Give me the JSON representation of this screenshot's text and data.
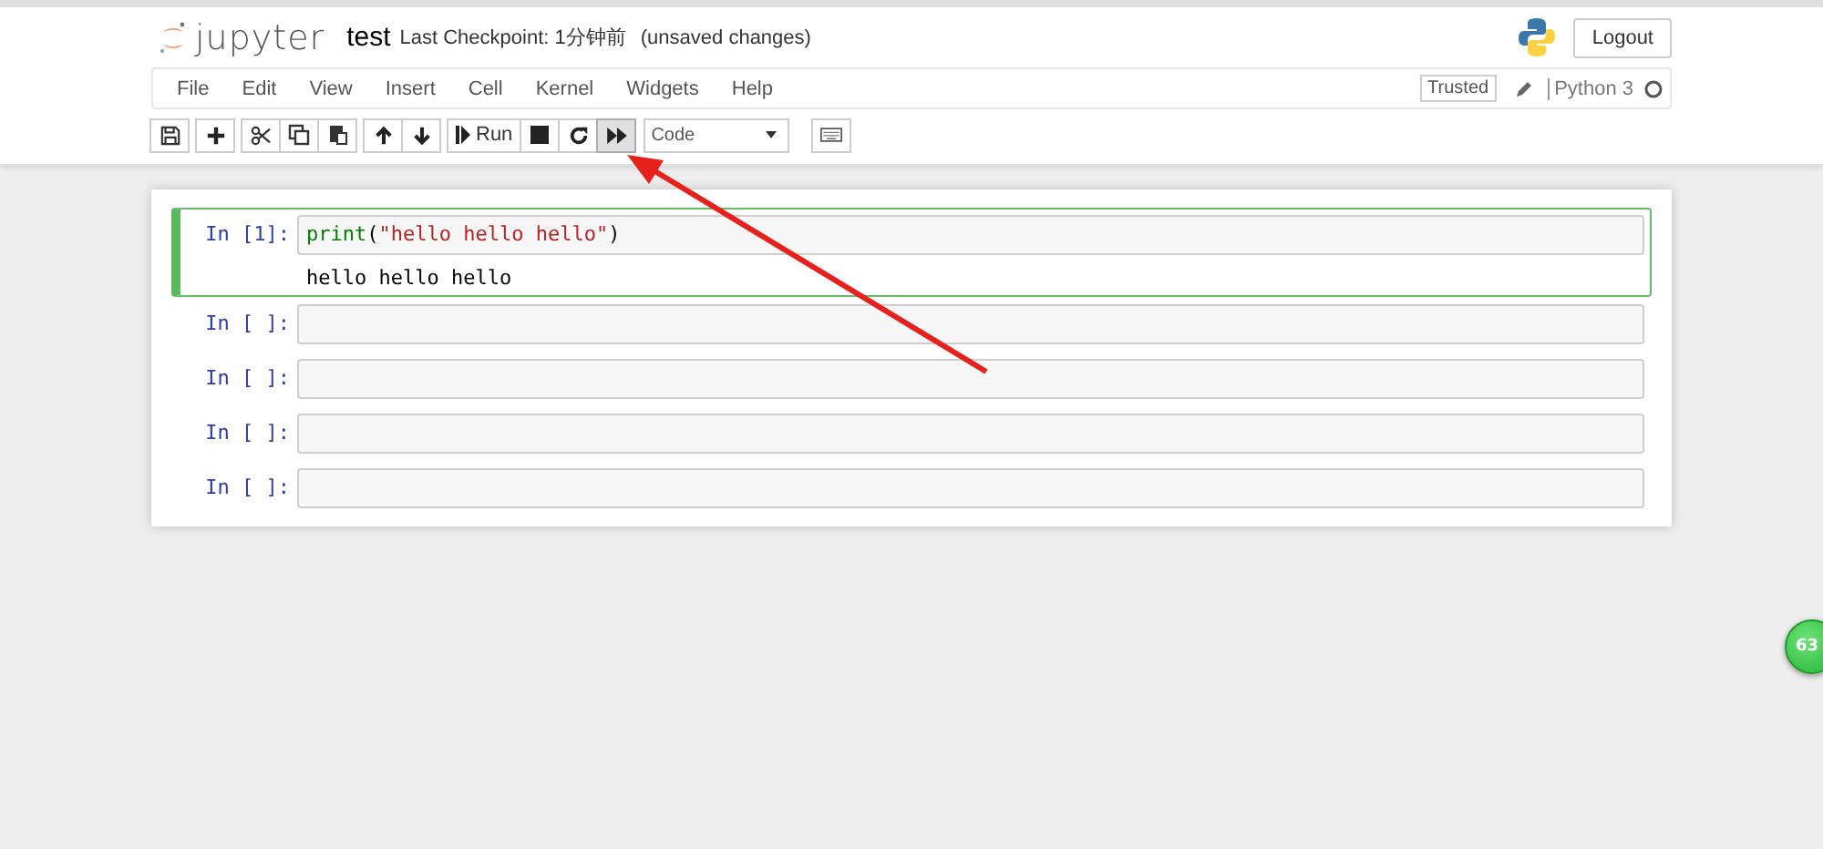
{
  "header": {
    "logo_text": "jupyter",
    "notebook_name": "test",
    "checkpoint": "Last Checkpoint: 1分钟前",
    "autosave_status": "(unsaved changes)",
    "logout": "Logout"
  },
  "menu": [
    "File",
    "Edit",
    "View",
    "Insert",
    "Cell",
    "Kernel",
    "Widgets",
    "Help"
  ],
  "kernel_status": {
    "trusted": "Trusted",
    "kernel_name": "Python 3",
    "busy": false
  },
  "toolbar": [
    [
      {
        "kind": "save",
        "pressed": false
      }
    ],
    [
      {
        "kind": "add",
        "pressed": false
      }
    ],
    [
      {
        "kind": "cut",
        "pressed": false
      },
      {
        "kind": "copy",
        "pressed": false
      },
      {
        "kind": "paste",
        "pressed": false
      }
    ],
    [
      {
        "kind": "up",
        "pressed": false
      },
      {
        "kind": "down",
        "pressed": false
      }
    ],
    [
      {
        "kind": "run",
        "label": "Run",
        "pressed": false
      },
      {
        "kind": "stop",
        "pressed": false
      },
      {
        "kind": "restart",
        "pressed": false
      },
      {
        "kind": "fastforward",
        "pressed": true
      }
    ],
    [
      {
        "kind": "select",
        "label": "Code"
      }
    ],
    [
      {
        "kind": "keyboard",
        "pressed": false
      }
    ]
  ],
  "cells": [
    {
      "prompt": "In [1]:",
      "selected": true,
      "tokens": [
        {
          "kind": "builtin",
          "text": "print"
        },
        {
          "kind": "paren",
          "text": "("
        },
        {
          "kind": "string",
          "text": "\"hello hello hello\""
        },
        {
          "kind": "paren",
          "text": ")"
        }
      ],
      "output": "hello hello hello"
    },
    {
      "prompt": "In [ ]:",
      "selected": false
    },
    {
      "prompt": "In [ ]:",
      "selected": false
    },
    {
      "prompt": "In [ ]:",
      "selected": false
    },
    {
      "prompt": "In [ ]:",
      "selected": false
    }
  ],
  "floating_badge": "63"
}
